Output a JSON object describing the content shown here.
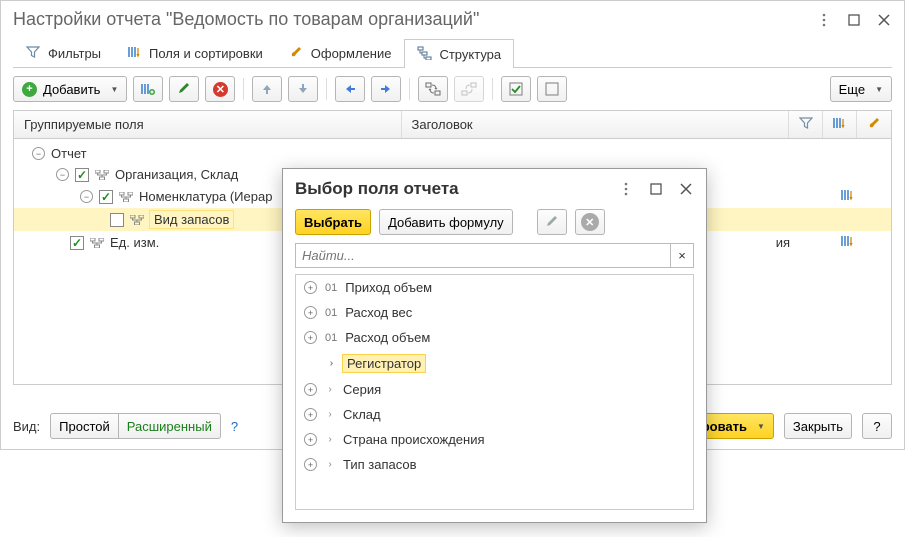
{
  "main": {
    "title": "Настройки отчета \"Ведомость по товарам организаций\"",
    "tabs": {
      "filters": "Фильтры",
      "fields_sort": "Поля и сортировки",
      "appearance": "Оформление",
      "structure": "Структура"
    },
    "toolbar": {
      "add": "Добавить",
      "more": "Еще"
    },
    "table": {
      "col_grouped": "Группируемые поля",
      "col_title": "Заголовок"
    },
    "tree": {
      "root": "Отчет",
      "org_warehouse": "Организация, Склад",
      "nomenclature": "Номенклатура (Иерар",
      "stock_type": "Вид запасов",
      "unit": "Ед. изм.",
      "right_label": "ия"
    },
    "footer": {
      "view_label": "Вид:",
      "simple": "Простой",
      "advanced": "Расширенный",
      "form_btn": "ровать",
      "close": "Закрыть",
      "help": "?"
    }
  },
  "dialog": {
    "title": "Выбор поля отчета",
    "select_btn": "Выбрать",
    "add_formula": "Добавить формулу",
    "search_placeholder": "Найти...",
    "fields": {
      "income_volume": "Приход объем",
      "expense_weight": "Расход вес",
      "expense_volume": "Расход объем",
      "registrar": "Регистратор",
      "series": "Серия",
      "warehouse": "Склад",
      "origin_country": "Страна происхождения",
      "stock_type": "Тип запасов"
    },
    "badge": "01"
  }
}
